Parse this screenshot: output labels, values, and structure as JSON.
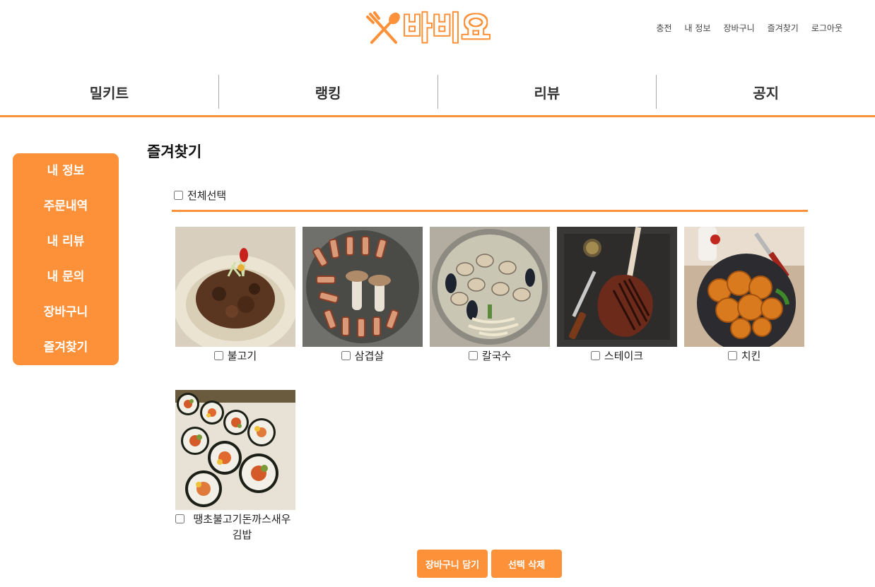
{
  "header": {
    "logo_text": "바비요",
    "top_links": [
      "충전",
      "내 정보",
      "장바구니",
      "즐겨찾기",
      "로그아웃"
    ]
  },
  "main_nav": [
    "밀키트",
    "랭킹",
    "리뷰",
    "공지"
  ],
  "side_menu": [
    "내 정보",
    "주문내역",
    "내 리뷰",
    "내 문의",
    "장바구니",
    "즐겨찾기"
  ],
  "page": {
    "title": "즐겨찾기",
    "select_all_label": "전체선택"
  },
  "favorites": [
    {
      "name": "불고기"
    },
    {
      "name": "삼겹살"
    },
    {
      "name": "칼국수"
    },
    {
      "name": "스테이크"
    },
    {
      "name": "치킨"
    },
    {
      "name": "땡초불고기돈까스새우김밥"
    }
  ],
  "actions": {
    "add_to_cart": "장바구니 담기",
    "delete_selected": "선택 삭제"
  },
  "colors": {
    "accent": "#FD9139"
  }
}
